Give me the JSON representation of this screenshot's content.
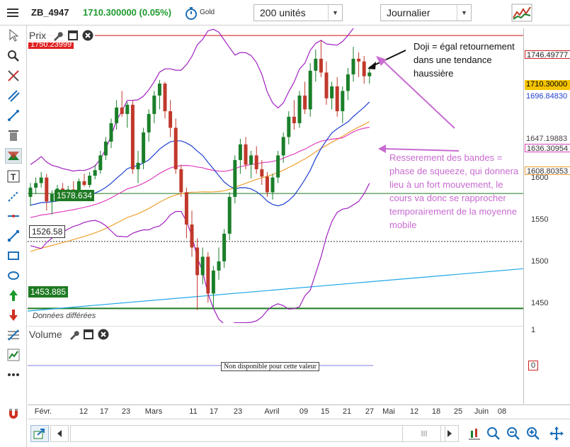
{
  "toolbar": {
    "symbol": "ZB_4947",
    "price": "1710.300000 (0.05%)",
    "gold_label": "Gold",
    "units_select": "200 unités",
    "period_select": "Journalier"
  },
  "panels": {
    "price_title": "Prix",
    "volume_title": "Volume",
    "delayed_note": "Données différées",
    "volume_unavailable": "Non disponible pour cette valeur"
  },
  "levels": {
    "red_top": "1750.23999",
    "green_mid": "1578.634",
    "black_dotted": "1526.58",
    "green_low": "1453.885"
  },
  "right_axis": {
    "ticks": [
      "1600",
      "1550",
      "1500",
      "1450"
    ],
    "tag_upper_band": "1746.49777",
    "tag_last": "1710.30000",
    "tag_ma": "1696.84830",
    "tag_mid1": "1647.19883",
    "tag_mid2": "1636.30954",
    "tag_ma200": "1608.80353",
    "volume_ticks": [
      "1",
      "0"
    ]
  },
  "bottom_axis": {
    "dates": [
      "Févr.",
      "12",
      "17",
      "23",
      "Mars",
      "11",
      "17",
      "23",
      "Avril",
      "09",
      "15",
      "21",
      "27",
      "Mai",
      "12",
      "18",
      "25",
      "Juin",
      "08"
    ]
  },
  "annotations": {
    "doji": "Doji = égal retournement dans une tendance haussière",
    "squeeze": "Resserement des bandes = phase de squeeze, qui donnera lieu à un fort mouvement, le cours va donc se rapprocher temporairement de la moyenne mobile"
  },
  "colors": {
    "up": "#1b7f2a",
    "down": "#c0392b",
    "bollinger": "#a020c0",
    "ma_short": "#1f3fd0",
    "ma_mid": "#e040c0",
    "ma_long": "#f0a030",
    "trendline": "#1ea7e8",
    "resistance": "#d01010",
    "support": "#1e7a22"
  },
  "chart_data": {
    "type": "candlestick",
    "ylim": [
      1438,
      1758
    ],
    "candles": [
      {
        "o": 1575,
        "h": 1590,
        "l": 1565,
        "c": 1585
      },
      {
        "o": 1585,
        "h": 1596,
        "l": 1578,
        "c": 1590
      },
      {
        "o": 1590,
        "h": 1602,
        "l": 1585,
        "c": 1596
      },
      {
        "o": 1596,
        "h": 1600,
        "l": 1560,
        "c": 1570
      },
      {
        "o": 1570,
        "h": 1582,
        "l": 1556,
        "c": 1578
      },
      {
        "o": 1578,
        "h": 1588,
        "l": 1570,
        "c": 1584
      },
      {
        "o": 1584,
        "h": 1590,
        "l": 1575,
        "c": 1578
      },
      {
        "o": 1578,
        "h": 1587,
        "l": 1572,
        "c": 1583
      },
      {
        "o": 1583,
        "h": 1592,
        "l": 1577,
        "c": 1580
      },
      {
        "o": 1580,
        "h": 1595,
        "l": 1578,
        "c": 1592
      },
      {
        "o": 1592,
        "h": 1600,
        "l": 1586,
        "c": 1588
      },
      {
        "o": 1588,
        "h": 1602,
        "l": 1585,
        "c": 1598
      },
      {
        "o": 1598,
        "h": 1610,
        "l": 1594,
        "c": 1604
      },
      {
        "o": 1604,
        "h": 1625,
        "l": 1600,
        "c": 1620
      },
      {
        "o": 1620,
        "h": 1640,
        "l": 1615,
        "c": 1635
      },
      {
        "o": 1635,
        "h": 1660,
        "l": 1628,
        "c": 1655
      },
      {
        "o": 1655,
        "h": 1680,
        "l": 1648,
        "c": 1672
      },
      {
        "o": 1672,
        "h": 1690,
        "l": 1662,
        "c": 1665
      },
      {
        "o": 1665,
        "h": 1678,
        "l": 1650,
        "c": 1675
      },
      {
        "o": 1675,
        "h": 1680,
        "l": 1600,
        "c": 1605
      },
      {
        "o": 1605,
        "h": 1625,
        "l": 1590,
        "c": 1612
      },
      {
        "o": 1612,
        "h": 1650,
        "l": 1605,
        "c": 1645
      },
      {
        "o": 1645,
        "h": 1670,
        "l": 1635,
        "c": 1665
      },
      {
        "o": 1665,
        "h": 1690,
        "l": 1655,
        "c": 1685
      },
      {
        "o": 1685,
        "h": 1702,
        "l": 1670,
        "c": 1698
      },
      {
        "o": 1698,
        "h": 1700,
        "l": 1660,
        "c": 1668
      },
      {
        "o": 1668,
        "h": 1680,
        "l": 1640,
        "c": 1650
      },
      {
        "o": 1650,
        "h": 1660,
        "l": 1600,
        "c": 1605
      },
      {
        "o": 1605,
        "h": 1610,
        "l": 1575,
        "c": 1580
      },
      {
        "o": 1580,
        "h": 1585,
        "l": 1530,
        "c": 1545
      },
      {
        "o": 1545,
        "h": 1560,
        "l": 1510,
        "c": 1520
      },
      {
        "o": 1520,
        "h": 1530,
        "l": 1452,
        "c": 1490
      },
      {
        "o": 1490,
        "h": 1520,
        "l": 1480,
        "c": 1510
      },
      {
        "o": 1510,
        "h": 1515,
        "l": 1460,
        "c": 1470
      },
      {
        "o": 1470,
        "h": 1500,
        "l": 1455,
        "c": 1495
      },
      {
        "o": 1495,
        "h": 1520,
        "l": 1485,
        "c": 1505
      },
      {
        "o": 1505,
        "h": 1540,
        "l": 1498,
        "c": 1535
      },
      {
        "o": 1535,
        "h": 1580,
        "l": 1528,
        "c": 1575
      },
      {
        "o": 1575,
        "h": 1620,
        "l": 1568,
        "c": 1615
      },
      {
        "o": 1615,
        "h": 1638,
        "l": 1600,
        "c": 1632
      },
      {
        "o": 1632,
        "h": 1640,
        "l": 1605,
        "c": 1610
      },
      {
        "o": 1610,
        "h": 1625,
        "l": 1595,
        "c": 1620
      },
      {
        "o": 1620,
        "h": 1630,
        "l": 1600,
        "c": 1605
      },
      {
        "o": 1605,
        "h": 1615,
        "l": 1588,
        "c": 1597
      },
      {
        "o": 1597,
        "h": 1602,
        "l": 1575,
        "c": 1580
      },
      {
        "o": 1580,
        "h": 1600,
        "l": 1572,
        "c": 1596
      },
      {
        "o": 1596,
        "h": 1625,
        "l": 1590,
        "c": 1620
      },
      {
        "o": 1620,
        "h": 1645,
        "l": 1612,
        "c": 1640
      },
      {
        "o": 1640,
        "h": 1668,
        "l": 1632,
        "c": 1662
      },
      {
        "o": 1662,
        "h": 1680,
        "l": 1648,
        "c": 1655
      },
      {
        "o": 1655,
        "h": 1690,
        "l": 1650,
        "c": 1685
      },
      {
        "o": 1685,
        "h": 1700,
        "l": 1665,
        "c": 1670
      },
      {
        "o": 1670,
        "h": 1720,
        "l": 1662,
        "c": 1712
      },
      {
        "o": 1712,
        "h": 1735,
        "l": 1700,
        "c": 1725
      },
      {
        "o": 1725,
        "h": 1745,
        "l": 1705,
        "c": 1710
      },
      {
        "o": 1710,
        "h": 1722,
        "l": 1675,
        "c": 1682
      },
      {
        "o": 1682,
        "h": 1700,
        "l": 1670,
        "c": 1695
      },
      {
        "o": 1695,
        "h": 1705,
        "l": 1662,
        "c": 1668
      },
      {
        "o": 1668,
        "h": 1695,
        "l": 1655,
        "c": 1690
      },
      {
        "o": 1690,
        "h": 1715,
        "l": 1680,
        "c": 1708
      },
      {
        "o": 1708,
        "h": 1738,
        "l": 1700,
        "c": 1725
      },
      {
        "o": 1725,
        "h": 1732,
        "l": 1705,
        "c": 1722
      },
      {
        "o": 1722,
        "h": 1728,
        "l": 1698,
        "c": 1706
      },
      {
        "o": 1706,
        "h": 1715,
        "l": 1698,
        "c": 1710
      }
    ]
  }
}
